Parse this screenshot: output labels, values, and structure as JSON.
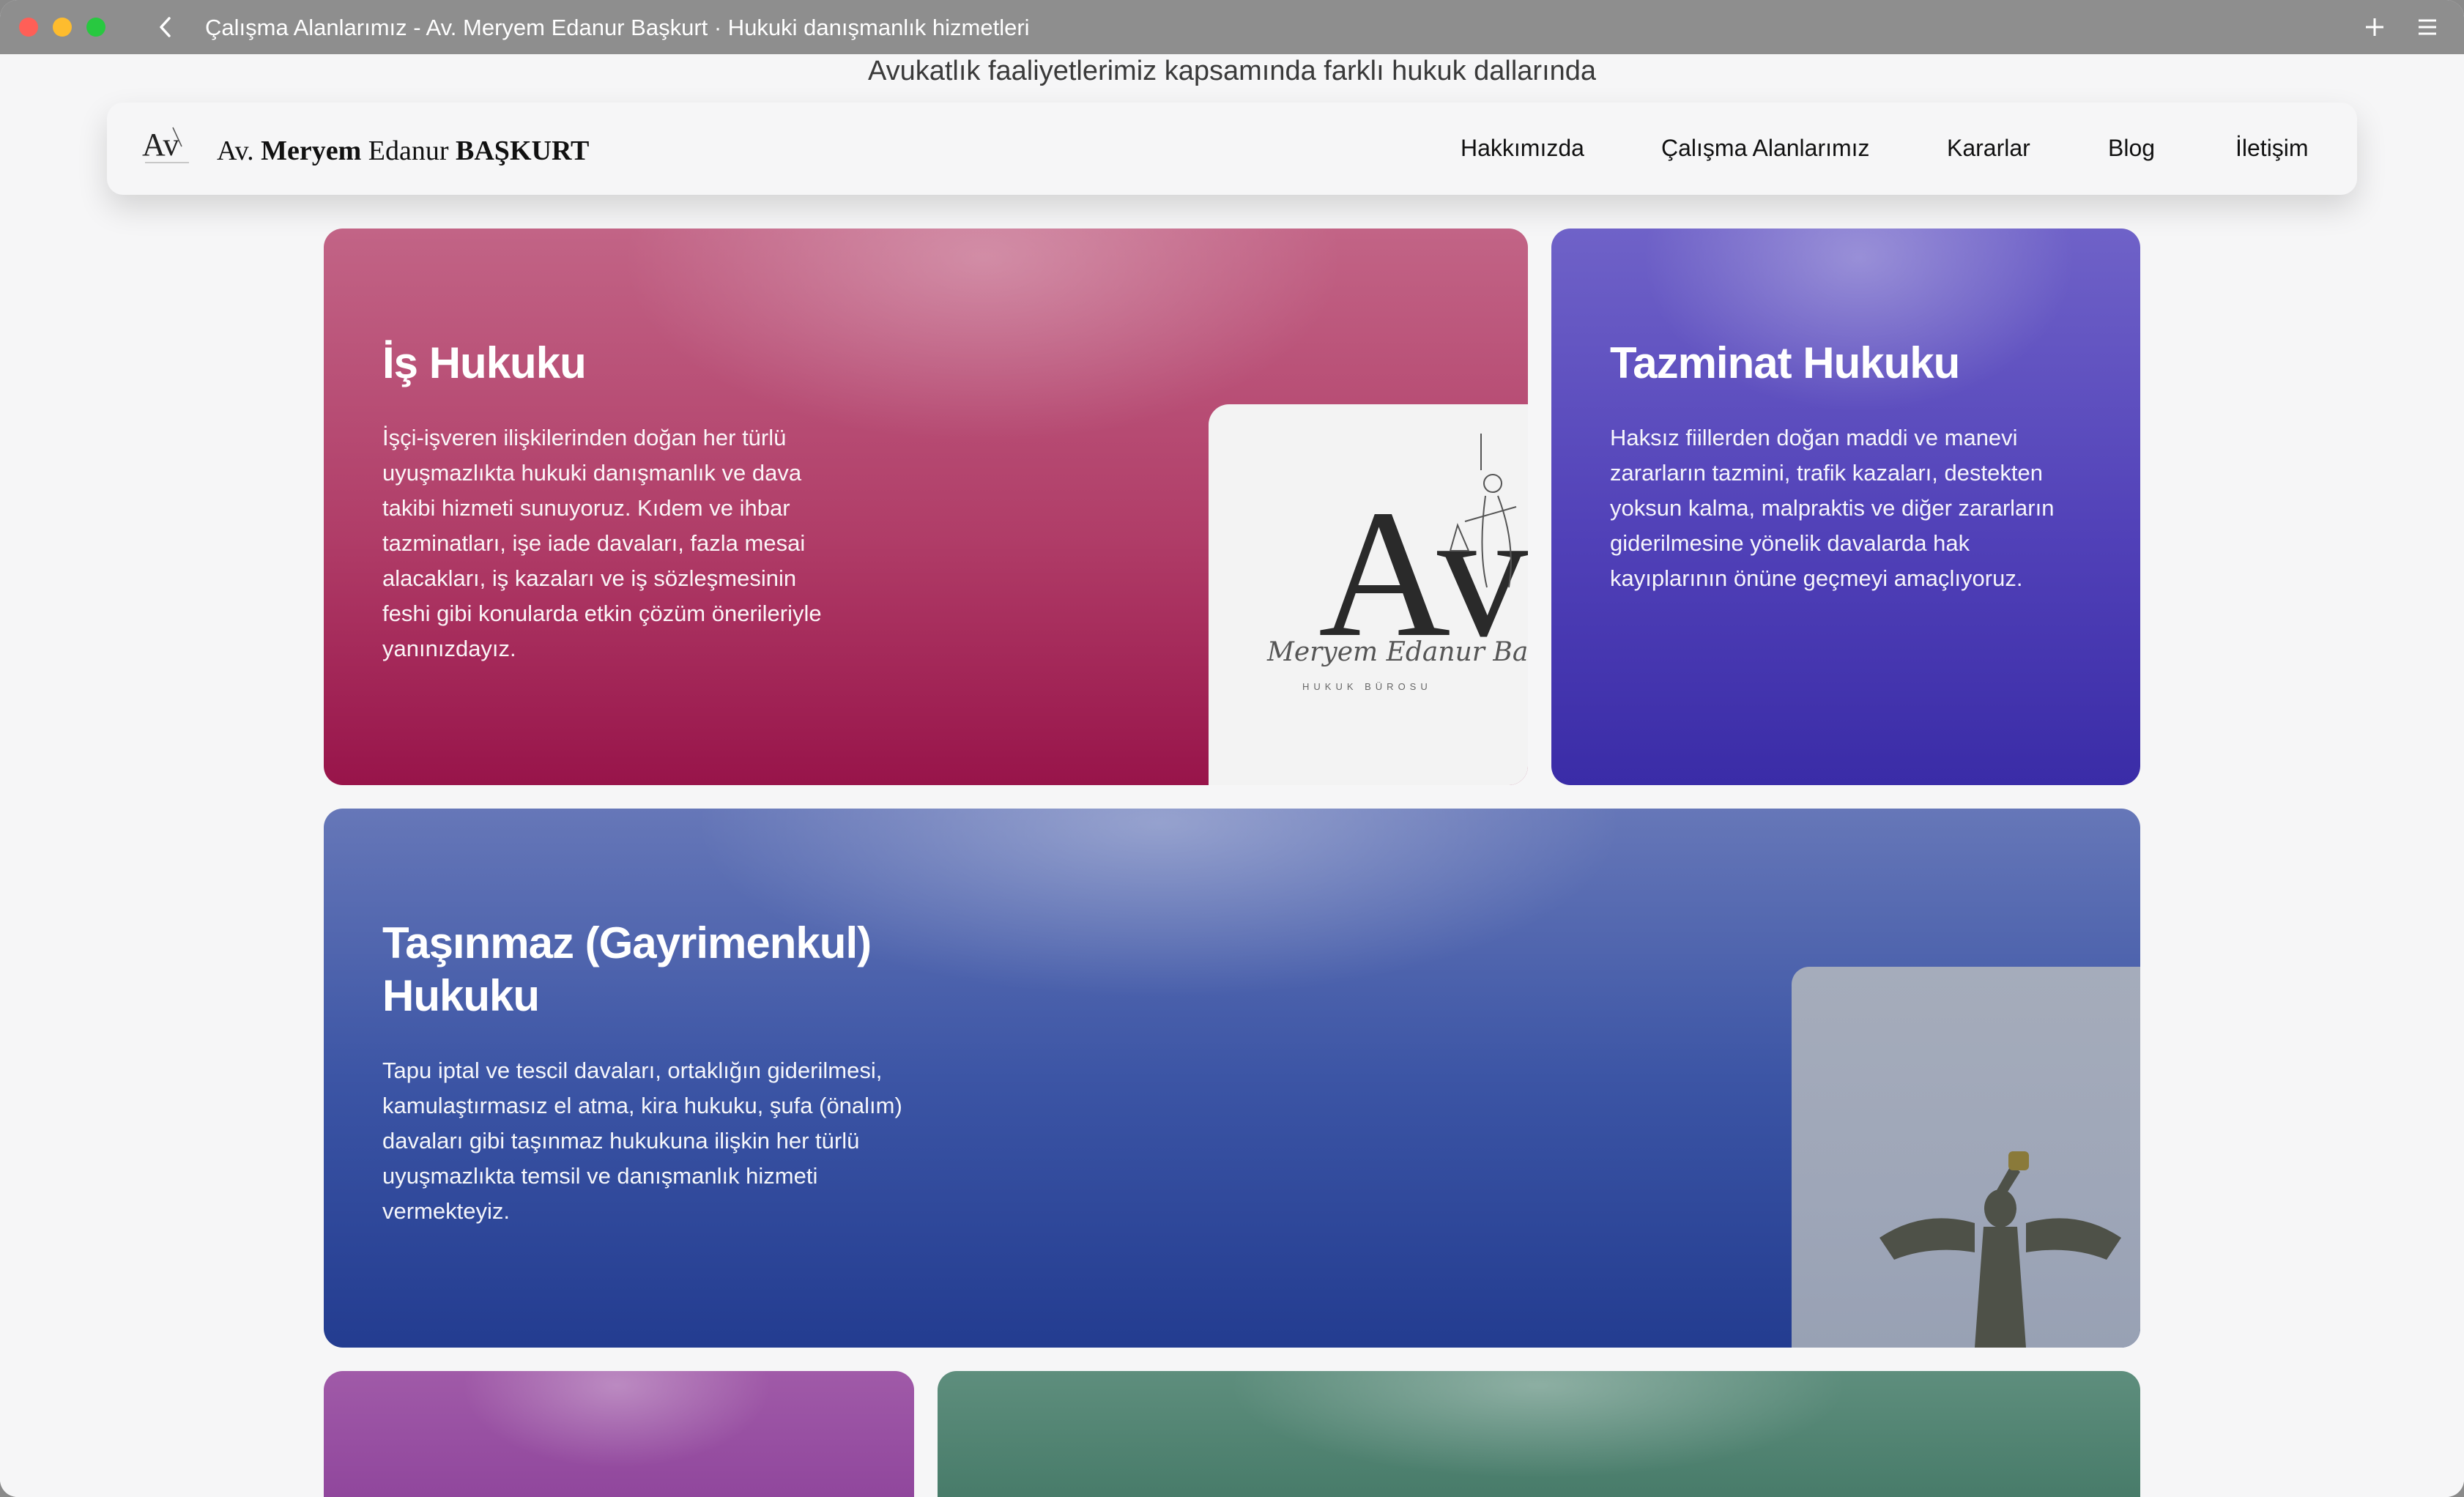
{
  "window": {
    "title": "Çalışma Alanlarımız - Av. Meryem Edanur Başkurt · Hukuki danışmanlık hizmetleri"
  },
  "page": {
    "subtitle": "Avukatlık faaliyetlerimiz kapsamında farklı hukuk dallarında"
  },
  "navbar": {
    "brand_prefix": "Av.",
    "brand_first": "Meryem",
    "brand_middle": "Edanur",
    "brand_last": "BAŞKURT",
    "logo_text": "Av",
    "links": [
      "Hakkımızda",
      "Çalışma Alanlarımız",
      "Kararlar",
      "Blog",
      "İletişim"
    ]
  },
  "cards": {
    "is": {
      "title": "İş Hukuku",
      "lines": [
        "İşçi-işveren ilişkilerinden doğan her türlü",
        "uyuşmazlıkta hukuki danışmanlık ve dava",
        "takibi hizmeti sunuyoruz. Kıdem ve ihbar",
        "tazminatları, işe iade davaları, fazla mesai",
        "alacakları, iş kazaları ve iş sözleşmesinin",
        "feshi gibi konularda etkin çözüm önerileriyle",
        "yanınızdayız."
      ],
      "image": {
        "logo_letters": "Av",
        "script": "Meryem Edanur Ba",
        "caption": "HUKUK BÜROSU"
      }
    },
    "tazminat": {
      "title": "Tazminat Hukuku",
      "lines": [
        "Haksız fiillerden doğan maddi ve manevi",
        "zararların tazmini, trafik kazaları, destekten",
        "yoksun kalma, malpraktis ve diğer zararların",
        "giderilmesine yönelik davalarda hak",
        "kayıplarının önüne geçmeyi amaçlıyoruz."
      ]
    },
    "tasinmaz": {
      "title_line1": "Taşınmaz (Gayrimenkul)",
      "title_line2": "Hukuku",
      "lines": [
        "Tapu iptal ve tescil davaları, ortaklığın giderilmesi,",
        "kamulaştırmasız el atma, kira hukuku, şufa (önalım)",
        "davaları gibi taşınmaz hukukuna ilişkin her türlü",
        "uyuşmazlıkta temsil ve danışmanlık hizmeti",
        "vermekteyiz."
      ]
    }
  },
  "colors": {
    "is_card": "#b03d68",
    "tazminat_card": "#5141b8",
    "tasinmaz_card": "#3c55a5",
    "purple_card": "#8a3f98",
    "green_card": "#3f7462"
  }
}
